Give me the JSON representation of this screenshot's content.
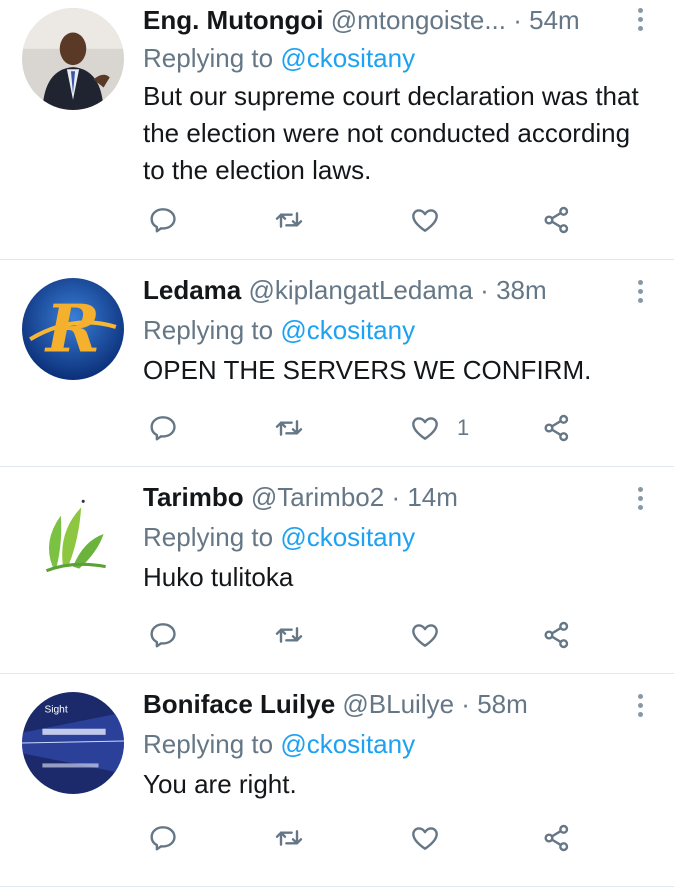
{
  "tweets": [
    {
      "name": "Eng. Mutongoi",
      "handle": "@mtongoiste...",
      "dot": "·",
      "time": "54m",
      "replying_prefix": "Replying to",
      "replying_to": "@ckositany",
      "text": "But our supreme court declaration was that the election were not conducted according to the election laws.",
      "like_count": ""
    },
    {
      "name": "Ledama",
      "handle": "@kiplangatLedama",
      "dot": "·",
      "time": "38m",
      "replying_prefix": "Replying to",
      "replying_to": "@ckositany",
      "text": "OPEN THE SERVERS WE CONFIRM.",
      "like_count": "1"
    },
    {
      "name": "Tarimbo",
      "handle": "@Tarimbo2",
      "dot": "·",
      "time": "14m",
      "replying_prefix": "Replying to",
      "replying_to": "@ckositany",
      "text": "Huko tulitoka",
      "like_count": ""
    },
    {
      "name": "Boniface Luilye",
      "handle": "@BLuilye",
      "dot": "·",
      "time": "58m",
      "replying_prefix": "Replying to",
      "replying_to": "@ckositany",
      "text": "You are right.",
      "like_count": "",
      "avatar_text": "Sight"
    }
  ],
  "colors": {
    "accent": "#1da1f2",
    "secondary_text": "#657786",
    "icon": "#657786",
    "divider": "#e1e8ed"
  },
  "icons": {
    "reply": "reply-icon",
    "retweet": "retweet-icon",
    "like": "heart-icon",
    "share": "share-icon",
    "more": "more-vertical-icon"
  }
}
